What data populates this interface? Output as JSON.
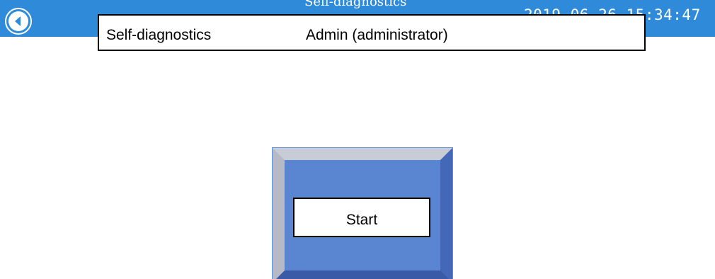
{
  "header": {
    "title_partial": "Self-diagnostics",
    "datetime": "2019-06-26 15:34:47"
  },
  "overlay": {
    "screen_name": "Self-diagnostics",
    "user": "Admin (administrator)"
  },
  "start_button": {
    "label": "Start"
  },
  "icons": {
    "back": "back-arrow-circle-icon"
  },
  "colors": {
    "header_bg": "#2f8bd9",
    "panel_face": "#5a85d0",
    "panel_light_bevel": "#c8ccd6",
    "panel_dark_bevel": "#3a5aa8"
  }
}
